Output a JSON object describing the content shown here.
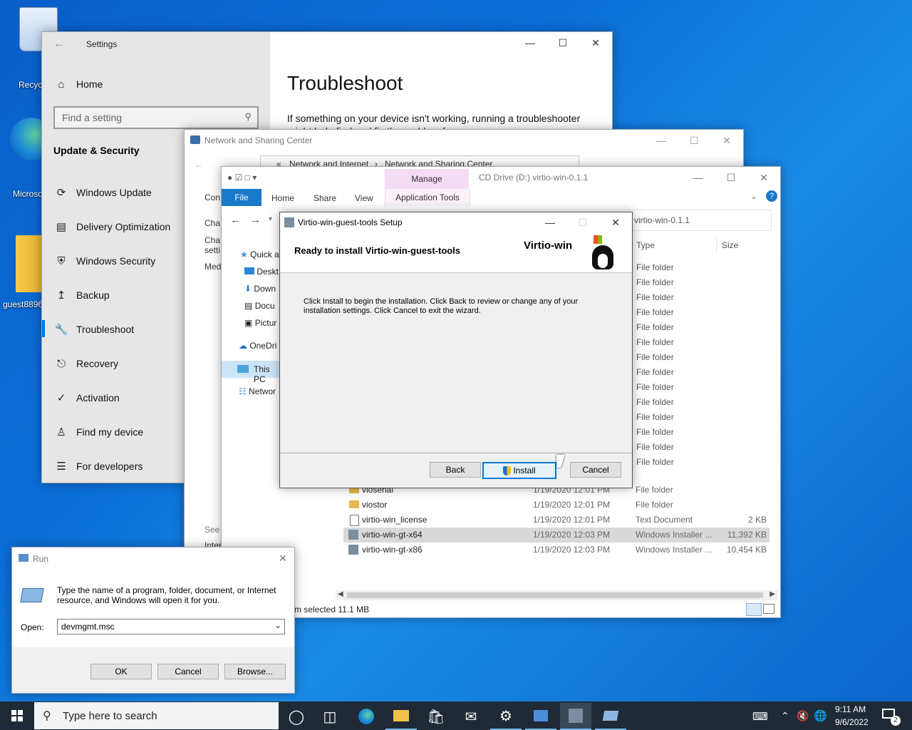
{
  "desktop": {
    "icons": [
      {
        "label": "Recyc"
      },
      {
        "label": "Microso"
      },
      {
        "label": "guest8896"
      }
    ]
  },
  "settings": {
    "title": "Settings",
    "home": "Home",
    "search_placeholder": "Find a setting",
    "section": "Update & Security",
    "nav": [
      {
        "label": "Windows Update"
      },
      {
        "label": "Delivery Optimization"
      },
      {
        "label": "Windows Security"
      },
      {
        "label": "Backup"
      },
      {
        "label": "Troubleshoot"
      },
      {
        "label": "Recovery"
      },
      {
        "label": "Activation"
      },
      {
        "label": "Find my device"
      },
      {
        "label": "For developers"
      }
    ],
    "heading": "Troubleshoot",
    "body": "If something on your device isn't working, running a troubleshooter",
    "body2": "might help find and fix the problem for you."
  },
  "network": {
    "title": "Network and Sharing Center",
    "breadcrumb1": "Network and Internet",
    "breadcrumb2": "Network and Sharing Center",
    "side": [
      "Con",
      "Cha",
      "Cha",
      "setti",
      "Med"
    ],
    "see": "See",
    "inter": "Inter"
  },
  "explorer": {
    "title": "CD Drive (D:) virtio-win-0.1.1",
    "manage": "Manage",
    "tabs": [
      "File",
      "Home",
      "Share",
      "View"
    ],
    "app_tools": "Application Tools",
    "address": "virtio-win-0.1.1",
    "col_type": "Type",
    "col_size": "Size",
    "nav": [
      {
        "label": "Quick a"
      },
      {
        "label": "Deskt"
      },
      {
        "label": "Down"
      },
      {
        "label": "Docu"
      },
      {
        "label": "Pictur"
      },
      {
        "label": "OneDri"
      },
      {
        "label": "This PC"
      },
      {
        "label": "Networ"
      }
    ],
    "folder_types": [
      "File folder",
      "File folder",
      "File folder",
      "File folder",
      "File folder",
      "File folder",
      "File folder",
      "File folder",
      "File folder",
      "File folder",
      "File folder",
      "File folder",
      "File folder",
      "File folder"
    ],
    "rows": [
      {
        "name": "vioserial",
        "date": "1/19/2020 12:01 PM",
        "type": "File folder",
        "size": ""
      },
      {
        "name": "viostor",
        "date": "1/19/2020 12:01 PM",
        "type": "File folder",
        "size": ""
      },
      {
        "name": "virtio-win_license",
        "date": "1/19/2020 12:01 PM",
        "type": "Text Document",
        "size": "2 KB"
      },
      {
        "name": "virtio-win-gt-x64",
        "date": "1/19/2020 12:03 PM",
        "type": "Windows Installer ...",
        "size": "11,392 KB"
      },
      {
        "name": "virtio-win-gt-x86",
        "date": "1/19/2020 12:03 PM",
        "type": "Windows Installer ...",
        "size": "10,454 KB"
      }
    ],
    "status": "m selected  11.1 MB"
  },
  "setup": {
    "title": "Virtio-win-guest-tools Setup",
    "heading": "Ready to install Virtio-win-guest-tools",
    "brand": "Virtio-win",
    "line1": "Click Install to begin the installation. Click Back to review or change any of your",
    "line2": "installation settings. Click Cancel to exit the wizard.",
    "back": "Back",
    "install": "Install",
    "cancel": "Cancel"
  },
  "run": {
    "title": "Run",
    "desc1": "Type the name of a program, folder, document, or Internet",
    "desc2": "resource, and Windows will open it for you.",
    "open_label": "Open:",
    "value": "devmgmt.msc",
    "ok": "OK",
    "cancel": "Cancel",
    "browse": "Browse..."
  },
  "taskbar": {
    "search_placeholder": "Type here to search",
    "time": "9:11 AM",
    "date": "9/6/2022",
    "notif_count": "2"
  },
  "colors": {
    "accent": "#0078d7",
    "manage_tab": "#f3dcf4",
    "taskbar": "#1f2a36"
  }
}
